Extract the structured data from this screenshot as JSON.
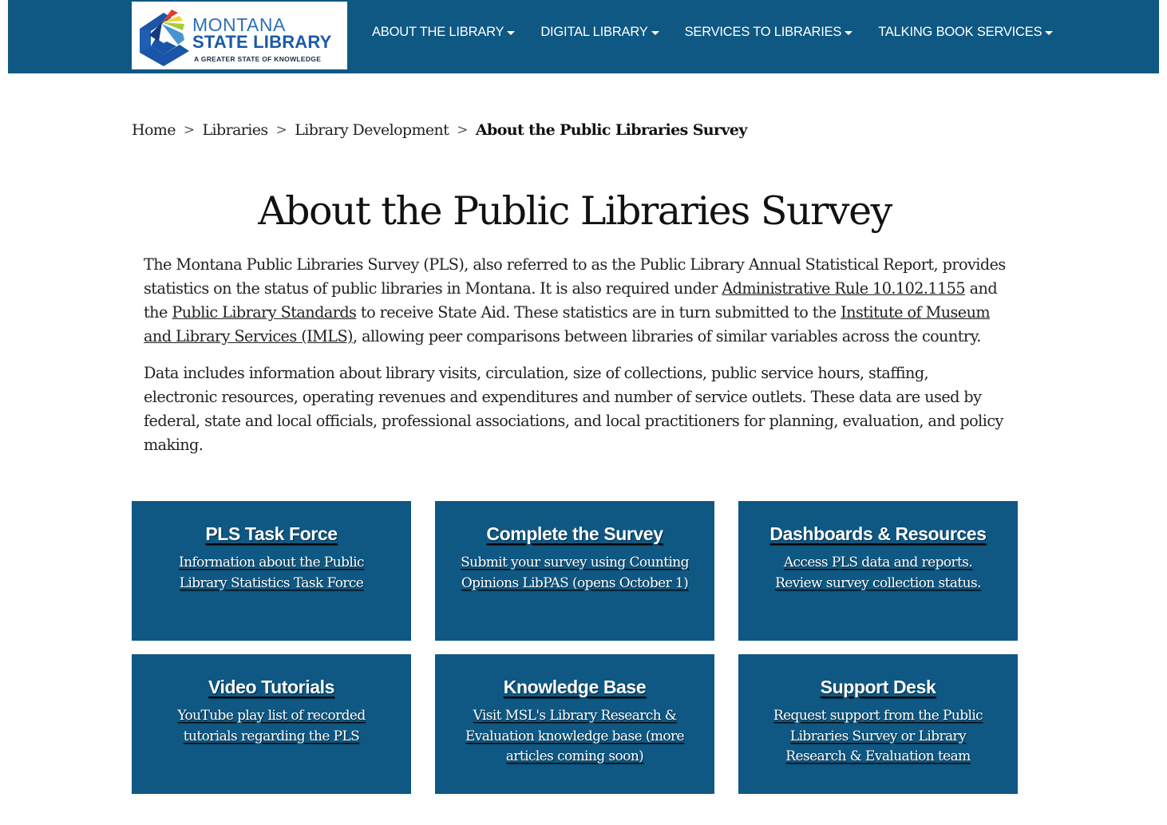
{
  "header": {
    "logo": {
      "line1": "MONTANA",
      "line2": "STATE LIBRARY",
      "tagline": "A GREATER STATE OF KNOWLEDGE",
      "colors": {
        "red": "#e63a2e",
        "yellow": "#f5d327",
        "green": "#a5cc3a",
        "light_blue": "#4a93d1",
        "dark_blue": "#1a55a8",
        "navy": "#173a7a"
      }
    },
    "nav": [
      {
        "label": "ABOUT THE LIBRARY",
        "icon": "caret-down-icon"
      },
      {
        "label": "DIGITAL LIBRARY",
        "icon": "caret-down-icon"
      },
      {
        "label": "SERVICES TO LIBRARIES",
        "icon": "caret-down-icon"
      },
      {
        "label": "TALKING BOOK SERVICES",
        "icon": "caret-down-icon"
      }
    ],
    "background": "#0f5883"
  },
  "breadcrumb": {
    "items": [
      "Home",
      "Libraries",
      "Library Development"
    ],
    "separator": ">",
    "current": "About the Public Libraries Survey"
  },
  "page": {
    "title": "About the Public Libraries Survey",
    "paragraph1": {
      "t1": "The Montana Public Libraries Survey (PLS), also referred to as the Public Library Annual Statistical Report, provides statistics on the status of public libraries in Montana. It is also required under ",
      "link1": "Administrative Rule 10.102.1155",
      "t2": " and the ",
      "link2": "Public Library Standards",
      "t3": " to receive State Aid. These statistics are in turn submitted to the ",
      "link3": "Institute of Museum and Library Services (IMLS)",
      "t4": ", allowing peer comparisons between libraries of similar variables across the country."
    },
    "paragraph2": "Data includes information about library visits, circulation, size of collections, public service hours, staffing, electronic resources, operating revenues and expenditures and number of service outlets. These data are used by federal, state and local officials, professional associations, and local practitioners for planning, evaluation, and policy making."
  },
  "tiles": [
    {
      "title": "PLS Task Force",
      "description": "Information about the Public Library Statistics Task Force"
    },
    {
      "title": "Complete the Survey",
      "description": "Submit your survey using Counting Opinions LibPAS (opens October 1)"
    },
    {
      "title": "Dashboards & Resources",
      "description": "Access PLS data and reports. Review survey collection status."
    },
    {
      "title": "Video Tutorials",
      "description": "YouTube play list of recorded tutorials regarding the PLS"
    },
    {
      "title": "Knowledge Base",
      "description": "Visit MSL's Library Research & Evaluation knowledge base (more articles coming soon)"
    },
    {
      "title": "Support Desk",
      "description": "Request support from the Public Libraries Survey or Library Research & Evaluation team"
    }
  ]
}
